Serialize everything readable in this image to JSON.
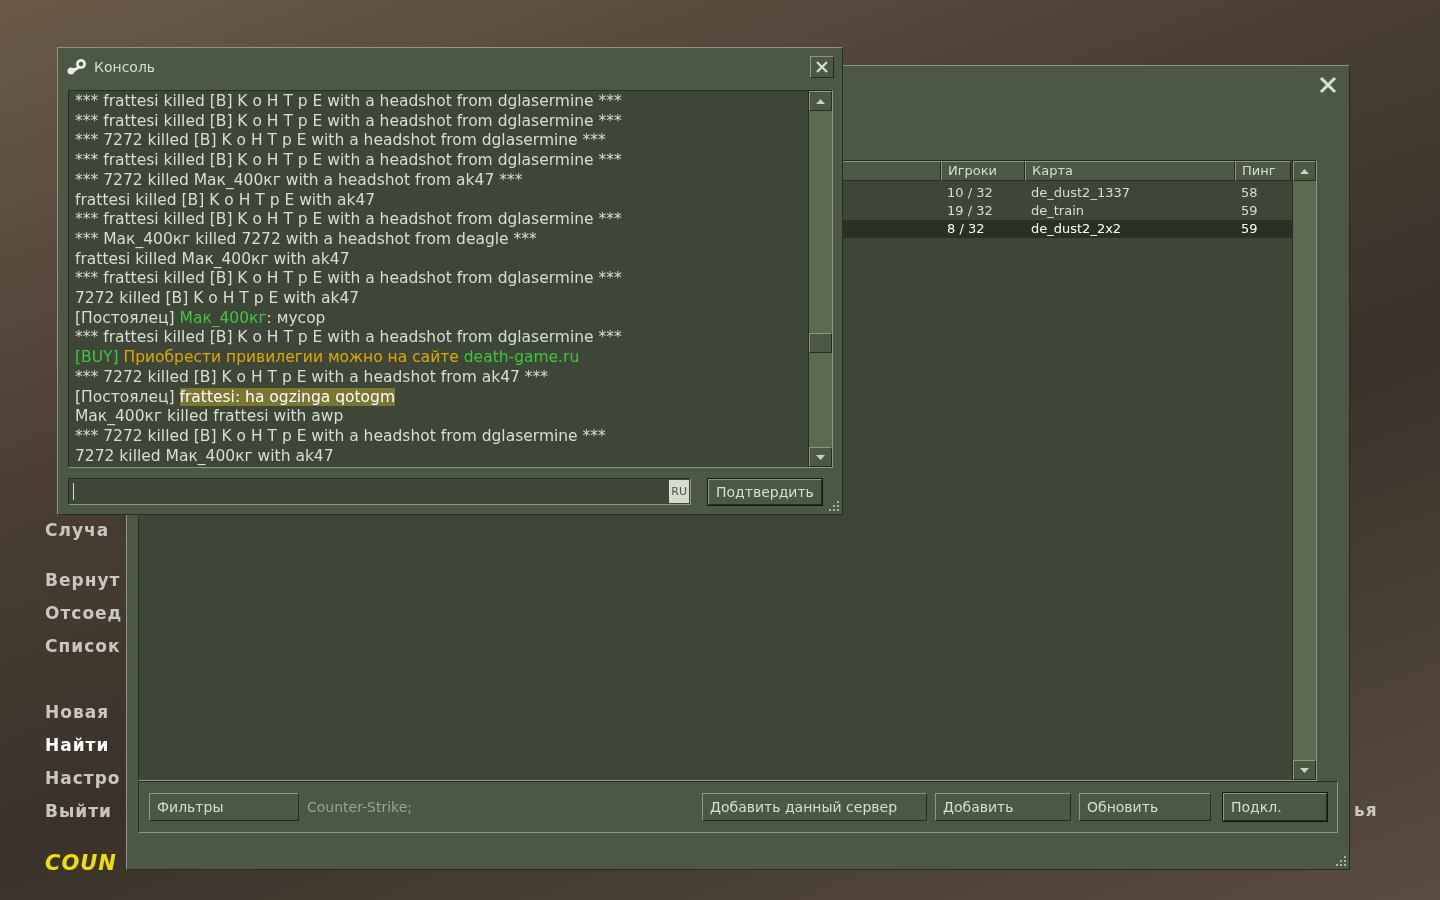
{
  "menu": {
    "groups": [
      {
        "items": [
          {
            "label": "Случа",
            "selected": false
          }
        ]
      },
      {
        "items": [
          {
            "label": "Вернут",
            "selected": false
          },
          {
            "label": "Отсоед",
            "selected": false
          },
          {
            "label": "Список",
            "selected": false
          }
        ]
      },
      {
        "items": [
          {
            "label": "Новая",
            "selected": false
          },
          {
            "label": "Найти",
            "selected": true
          },
          {
            "label": "Настро",
            "selected": false
          },
          {
            "label": "Выйти",
            "selected": false
          }
        ]
      }
    ],
    "logo": "COUN",
    "side_text": "ья"
  },
  "server_browser": {
    "columns": [
      "Игроки",
      "Карта",
      "Пинг"
    ],
    "rows": [
      {
        "players": "10 / 32",
        "map": "de_dust2_1337",
        "ping": "58",
        "selected": false
      },
      {
        "players": "19 / 32",
        "map": "de_train",
        "ping": "59",
        "selected": false
      },
      {
        "players": "8 / 32",
        "map": "de_dust2_2x2",
        "ping": "59",
        "selected": true
      }
    ],
    "filter_button": "Фильтры",
    "filter_text": "Counter-Strike;",
    "buttons": [
      {
        "label": "Добавить данный сервер",
        "default": false
      },
      {
        "label": "Добавить",
        "default": false
      },
      {
        "label": "Обновить",
        "default": false
      },
      {
        "label": "Подкл.",
        "default": true
      }
    ]
  },
  "console": {
    "title": "Консоль",
    "lines": [
      [
        {
          "text": "*** frattesi killed [B] K o H T p E with a headshot from dglasermine ***"
        }
      ],
      [
        {
          "text": "*** frattesi killed [B] K o H T p E with a headshot from dglasermine ***"
        }
      ],
      [
        {
          "text": "*** 7272 killed [B] K o H T p E with a headshot from dglasermine ***"
        }
      ],
      [
        {
          "text": "*** frattesi killed [B] K o H T p E with a headshot from dglasermine ***"
        }
      ],
      [
        {
          "text": "*** 7272 killed Мак_400кг with a headshot from ak47 ***"
        }
      ],
      [
        {
          "text": "frattesi killed [B] K o H T p E with ak47"
        }
      ],
      [
        {
          "text": "*** frattesi killed [B] K o H T p E with a headshot from dglasermine ***"
        }
      ],
      [
        {
          "text": "*** Мак_400кг killed 7272 with a headshot from deagle ***"
        }
      ],
      [
        {
          "text": "frattesi killed Мак_400кг with ak47"
        }
      ],
      [
        {
          "text": "*** frattesi killed [B] K o H T p E with a headshot from dglasermine ***"
        }
      ],
      [
        {
          "text": "7272 killed [B] K o H T p E with ak47"
        }
      ],
      [
        {
          "text": "[Постоялец] "
        },
        {
          "text": "Мак_400кг",
          "color": "#3cc83c"
        },
        {
          "text": ": мусор"
        }
      ],
      [
        {
          "text": "*** frattesi killed [B] K o H T p E with a headshot from dglasermine ***"
        }
      ],
      [
        {
          "text": "[BUY]",
          "color": "#3cc83c"
        },
        {
          "text": " Приобрести привилегии можно на сайте ",
          "color": "#e0a800"
        },
        {
          "text": "death-game.ru",
          "color": "#3cc83c"
        }
      ],
      [
        {
          "text": "*** 7272 killed [B] K o H T p E with a headshot from ak47 ***"
        }
      ],
      [
        {
          "text": "[Постоялец] "
        },
        {
          "text": "frattesi: ha ogzinga qotogm",
          "highlight": true
        }
      ],
      [
        {
          "text": "Мак_400кг killed frattesi with awp"
        }
      ],
      [
        {
          "text": "*** 7272 killed [B] K o H T p E with a headshot from dglasermine ***"
        }
      ],
      [
        {
          "text": "7272 killed Мак_400кг with ak47"
        }
      ]
    ],
    "input_lang": "RU",
    "submit_button": "Подтвердить"
  }
}
